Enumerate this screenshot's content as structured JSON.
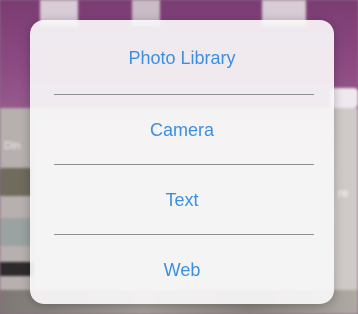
{
  "background": {
    "side_label": "Din",
    "right_label": "re"
  },
  "action_sheet": {
    "options": [
      {
        "label": "Photo Library"
      },
      {
        "label": "Camera"
      },
      {
        "label": "Text"
      },
      {
        "label": "Web"
      }
    ]
  },
  "colors": {
    "option_text": "#3b8fe0",
    "sheet_background": "#f8f6f8",
    "app_header": "#8c4a82"
  }
}
